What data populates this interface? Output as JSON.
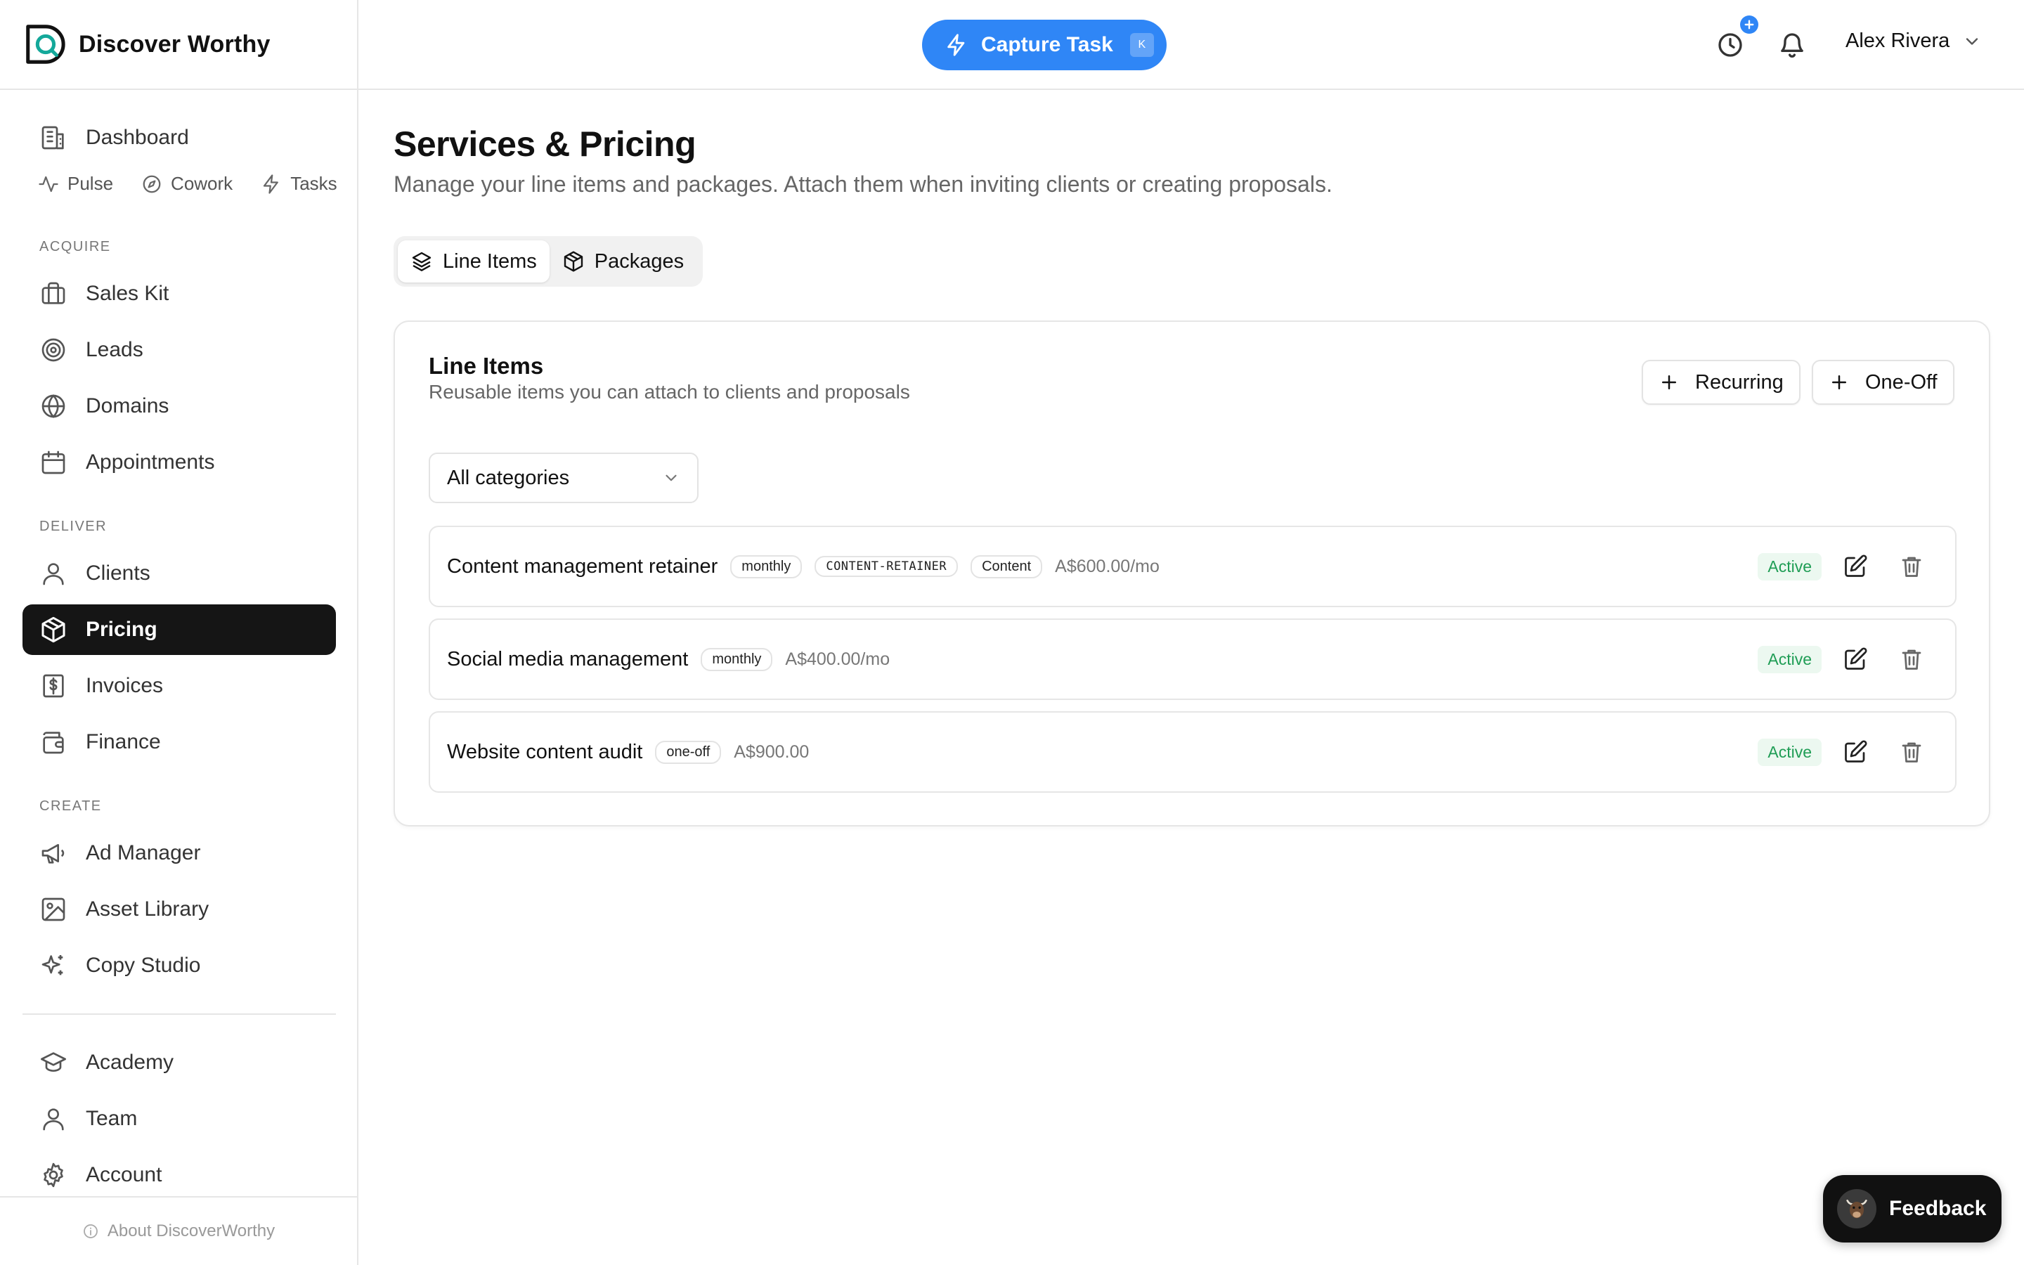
{
  "app": {
    "brand_name": "Discover Worthy",
    "accent_color": "#2f86f6",
    "active_nav_color": "#151515"
  },
  "sidebar": {
    "dashboard": {
      "label": "Dashboard",
      "icon": "dashboard-icon"
    },
    "quick_links": [
      {
        "label": "Pulse",
        "icon": "pulse-icon"
      },
      {
        "label": "Cowork",
        "icon": "compass-icon"
      },
      {
        "label": "Tasks",
        "icon": "lightning-icon"
      }
    ],
    "sections": {
      "acquire": "ACQUIRE",
      "deliver": "DELIVER",
      "create": "CREATE"
    },
    "acquire_items": [
      {
        "label": "Sales Kit",
        "icon": "briefcase-icon"
      },
      {
        "label": "Leads",
        "icon": "target-icon"
      },
      {
        "label": "Domains",
        "icon": "globe-icon"
      },
      {
        "label": "Appointments",
        "icon": "calendar-icon"
      }
    ],
    "deliver_items": [
      {
        "label": "Clients",
        "icon": "user-icon"
      },
      {
        "label": "Pricing",
        "icon": "box-icon",
        "active": true
      },
      {
        "label": "Invoices",
        "icon": "dollar-receipt-icon"
      },
      {
        "label": "Finance",
        "icon": "wallet-icon"
      }
    ],
    "create_items": [
      {
        "label": "Ad Manager",
        "icon": "megaphone-icon"
      },
      {
        "label": "Asset Library",
        "icon": "image-icon"
      },
      {
        "label": "Copy Studio",
        "icon": "sparkles-icon"
      }
    ],
    "bottom_items": [
      {
        "label": "Academy",
        "icon": "graduation-cap-icon"
      },
      {
        "label": "Team",
        "icon": "user-icon"
      },
      {
        "label": "Account",
        "icon": "gear-icon"
      }
    ],
    "about": "About DiscoverWorthy"
  },
  "topbar": {
    "capture_label": "Capture Task",
    "capture_shortcut": "K",
    "user_name": "Alex Rivera"
  },
  "page": {
    "title": "Services & Pricing",
    "subtitle": "Manage your line items and packages. Attach them when inviting clients or creating proposals.",
    "tabs": [
      {
        "label": "Line Items",
        "icon": "layers-icon",
        "active": true
      },
      {
        "label": "Packages",
        "icon": "box-icon",
        "active": false
      }
    ]
  },
  "line_items": {
    "title": "Line Items",
    "subtitle": "Reusable items you can attach to clients and proposals",
    "recurring_button": "Recurring",
    "one_off_button": "One-Off",
    "category_filter": "All categories",
    "items": [
      {
        "name": "Content management retainer",
        "frequency": "monthly",
        "code": "CONTENT-RETAINER",
        "category": "Content",
        "price": "A$600.00/mo",
        "status": "Active"
      },
      {
        "name": "Social media management",
        "frequency": "monthly",
        "price": "A$400.00/mo",
        "status": "Active"
      },
      {
        "name": "Website content audit",
        "frequency": "one-off",
        "price": "A$900.00",
        "status": "Active"
      }
    ]
  },
  "feedback": {
    "label": "Feedback"
  }
}
